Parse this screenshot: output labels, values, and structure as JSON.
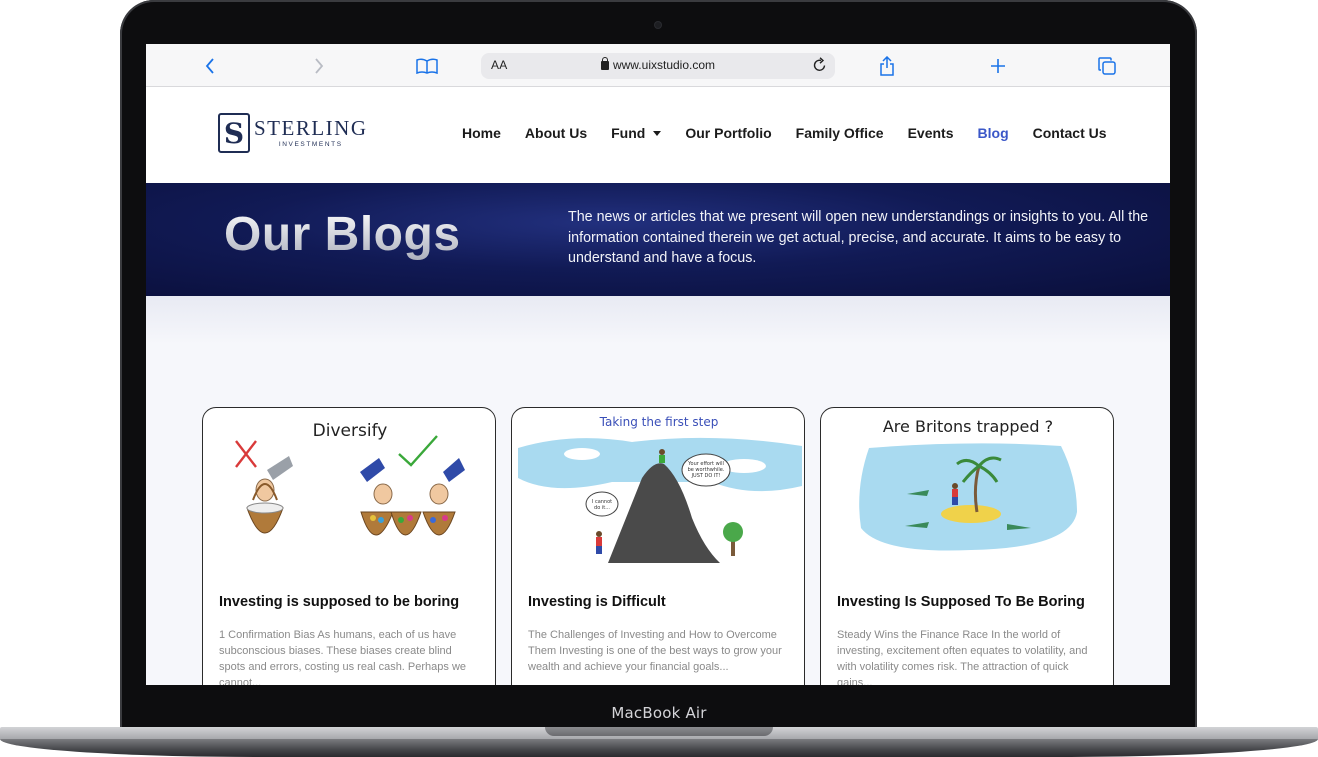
{
  "device": {
    "label": "MacBook Air"
  },
  "browser": {
    "reader_label": "AA",
    "url": "www.uixstudio.com",
    "icons": [
      "back-icon",
      "forward-icon",
      "bookmarks-icon",
      "lock-icon",
      "reload-icon",
      "share-icon",
      "new-tab-icon",
      "tabs-icon"
    ]
  },
  "site": {
    "logo": {
      "mark": "S",
      "name": "STERLING",
      "tagline": "INVESTMENTS"
    },
    "nav": [
      {
        "label": "Home"
      },
      {
        "label": "About Us"
      },
      {
        "label": "Fund"
      },
      {
        "label": "Our Portfolio"
      },
      {
        "label": "Family Office"
      },
      {
        "label": "Events"
      },
      {
        "label": "Blog",
        "active": true
      },
      {
        "label": "Contact Us"
      }
    ],
    "accent_color": "#3b57c8"
  },
  "hero": {
    "title": "Our Blogs",
    "text": "The news or articles that we present will open new understandings or insights to you. All the information contained therein we get actual, precise, and accurate. It aims to be easy to understand and have a focus."
  },
  "cards": [
    {
      "art_caption": "Diversify",
      "title": "Investing is supposed to be boring",
      "excerpt": "1 Confirmation Bias  As humans, each of us have subconscious biases. These biases create blind spots and errors, costing us real cash. Perhaps we cannot..."
    },
    {
      "art_caption": "Taking the first step",
      "bubble_top": "Your effort will be worthwhile. JUST DO IT!",
      "bubble_bottom": "I cannot do it...",
      "title": "Investing is Difficult",
      "excerpt": "The Challenges of Investing and How to Overcome Them Investing is one of the best ways to grow your wealth and achieve your financial goals..."
    },
    {
      "art_caption": "Are Britons trapped ?",
      "title": "Investing Is Supposed To Be Boring",
      "excerpt": "Steady Wins the Finance Race In the world of investing, excitement often equates to volatility, and with volatility comes risk. The attraction of quick gains..."
    }
  ]
}
